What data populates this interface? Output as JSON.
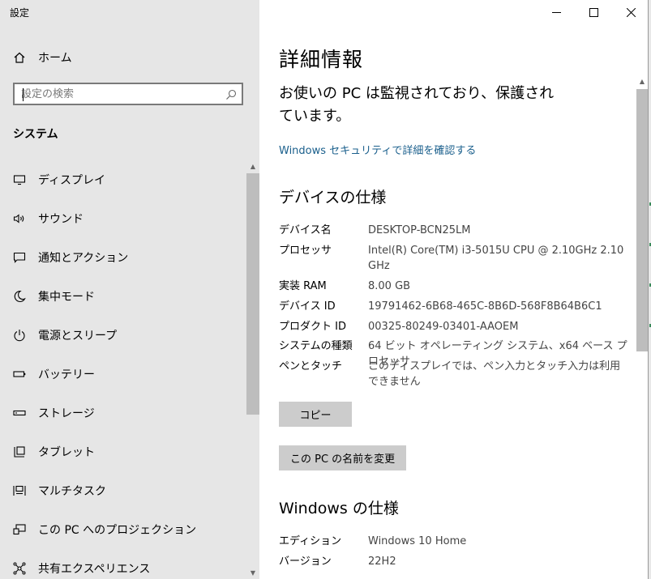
{
  "app_title": "設定",
  "home_label": "ホーム",
  "search": {
    "placeholder": "設定の検索"
  },
  "section_title": "システム",
  "nav": [
    {
      "label": "ディスプレイ",
      "icon": "monitor-icon"
    },
    {
      "label": "サウンド",
      "icon": "speaker-icon"
    },
    {
      "label": "通知とアクション",
      "icon": "notification-icon"
    },
    {
      "label": "集中モード",
      "icon": "moon-icon"
    },
    {
      "label": "電源とスリープ",
      "icon": "power-icon"
    },
    {
      "label": "バッテリー",
      "icon": "battery-icon"
    },
    {
      "label": "ストレージ",
      "icon": "storage-icon"
    },
    {
      "label": "タブレット",
      "icon": "tablet-icon"
    },
    {
      "label": "マルチタスク",
      "icon": "multitask-icon"
    },
    {
      "label": "この PC へのプロジェクション",
      "icon": "projection-icon"
    },
    {
      "label": "共有エクスペリエンス",
      "icon": "share-icon"
    }
  ],
  "main": {
    "title": "詳細情報",
    "protection_text": "お使いの PC は監視されており、保護されています。",
    "security_link": "Windows セキュリティで詳細を確認する",
    "device_heading": "デバイスの仕様",
    "device_specs": [
      {
        "key": "デバイス名",
        "value": "DESKTOP-BCN25LM"
      },
      {
        "key": "プロセッサ",
        "value": "Intel(R) Core(TM) i3-5015U CPU @ 2.10GHz   2.10 GHz"
      },
      {
        "key": "実装 RAM",
        "value": "8.00 GB"
      },
      {
        "key": "デバイス ID",
        "value": "19791462-6B68-465C-8B6D-568F8B64B6C1"
      },
      {
        "key": "プロダクト ID",
        "value": "00325-80249-03401-AAOEM"
      },
      {
        "key": "システムの種類",
        "value": "64 ビット オペレーティング システム、x64 ベース プロセッサ"
      },
      {
        "key": "ペンとタッチ",
        "value": "このディスプレイでは、ペン入力とタッチ入力は利用できません"
      }
    ],
    "copy_button": "コピー",
    "rename_button": "この PC の名前を変更",
    "windows_heading": "Windows の仕様",
    "windows_specs": [
      {
        "key": "エディション",
        "value": "Windows 10 Home"
      },
      {
        "key": "バージョン",
        "value": "22H2"
      }
    ]
  }
}
